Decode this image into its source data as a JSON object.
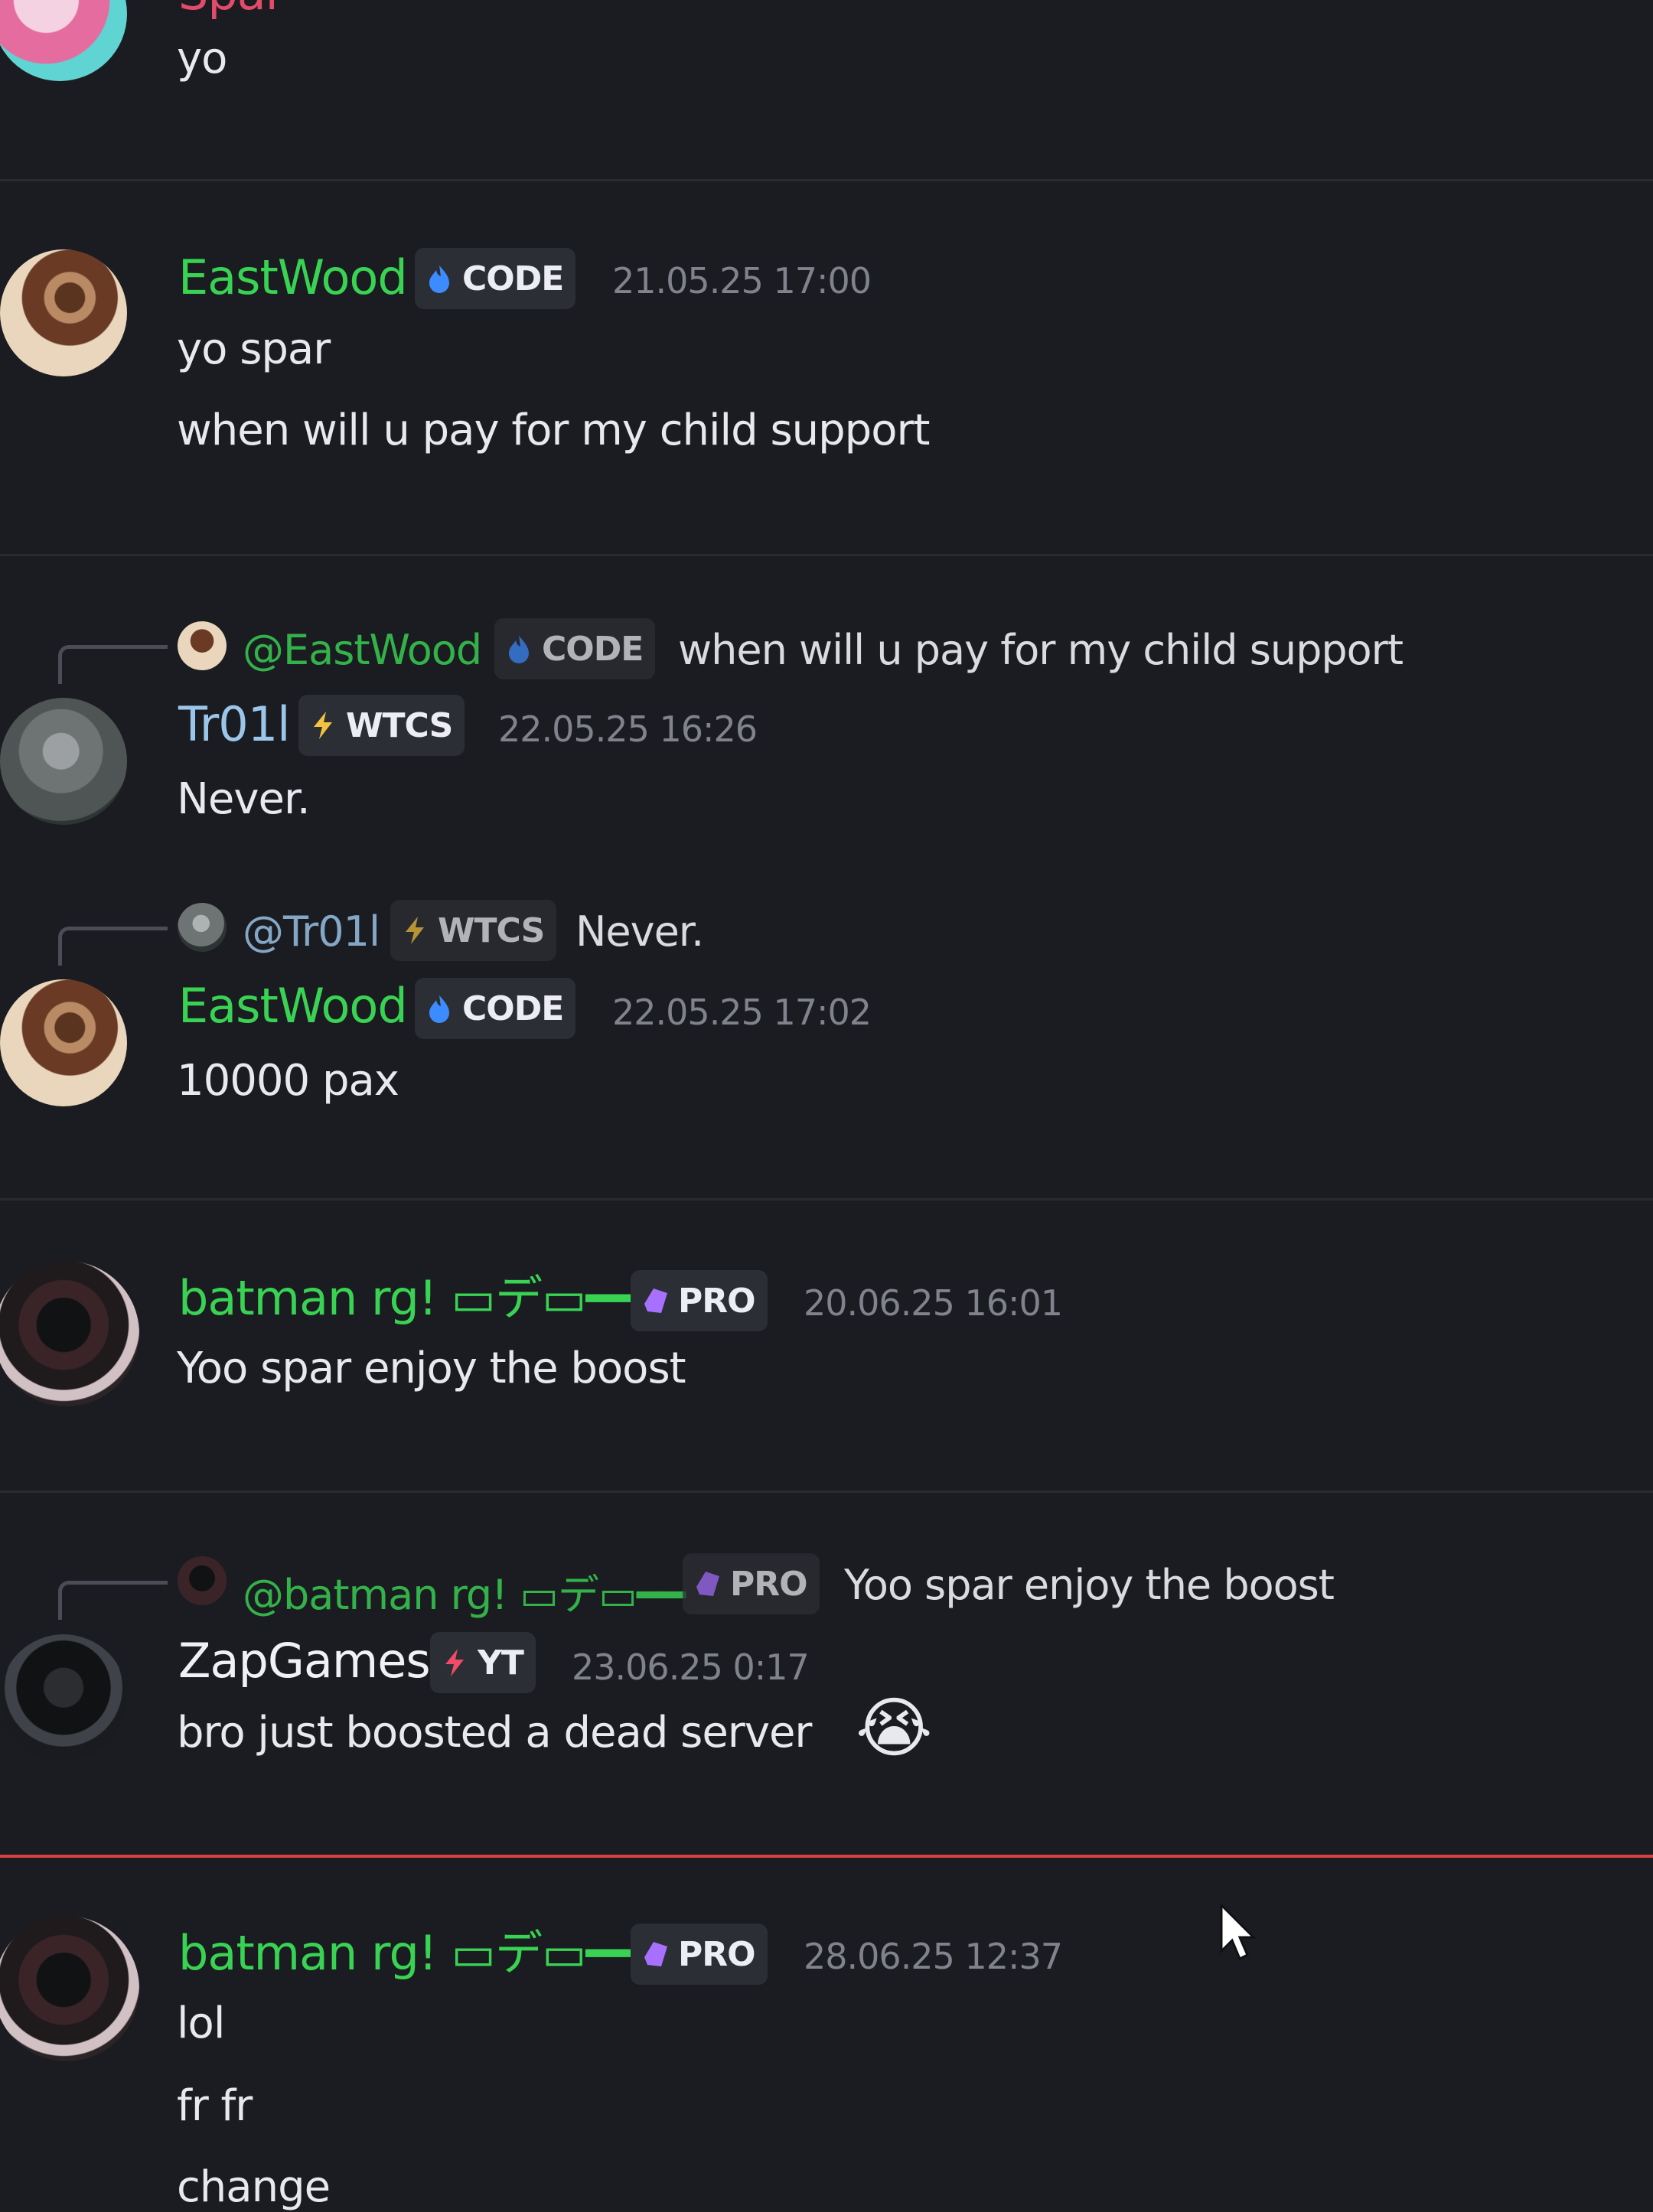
{
  "colors": {
    "background": "#1b1c21",
    "separator": "#2a2b31",
    "new_divider": "#d8413f",
    "green_name": "#39d353",
    "blue_name": "#9bc6e9",
    "timestamp": "#80838c"
  },
  "top": {
    "author": "Spar",
    "text": "yo"
  },
  "messages": [
    {
      "author": "EastWood",
      "tag": "CODE",
      "tag_icon": "blue-flame-icon",
      "timestamp": "21.05.25 17:00",
      "lines": [
        "yo spar",
        "when will u pay for my child support"
      ]
    },
    {
      "reply": {
        "author": "@EastWood",
        "tag": "CODE",
        "text": "when will u pay for my child support"
      },
      "author": "Tr01l",
      "tag": "WTCS",
      "tag_icon": "lightning-icon",
      "timestamp": "22.05.25 16:26",
      "lines": [
        "Never."
      ]
    },
    {
      "reply": {
        "author": "@Tr01l",
        "tag": "WTCS",
        "text": "Never."
      },
      "author": "EastWood",
      "tag": "CODE",
      "tag_icon": "blue-flame-icon",
      "timestamp": "22.05.25 17:02",
      "lines": [
        "10000 pax"
      ]
    },
    {
      "author": "batman rg! ▭デ▭━━",
      "tag": "PRO",
      "tag_icon": "purple-crystal-icon",
      "timestamp": "20.06.25 16:01",
      "lines": [
        "Yoo spar enjoy the boost"
      ]
    },
    {
      "reply": {
        "author": "@batman rg! ▭デ▭━━",
        "tag": "PRO",
        "text": "Yoo spar enjoy the boost"
      },
      "author": "ZapGames",
      "tag": "YT",
      "tag_icon": "red-lightning-icon",
      "timestamp": "23.06.25 0:17",
      "lines": [
        "bro just boosted a dead server",
        "😭"
      ]
    },
    {
      "author": "batman rg! ▭デ▭━━",
      "tag": "PRO",
      "tag_icon": "purple-crystal-icon",
      "timestamp": "28.06.25 12:37",
      "lines": [
        "lol",
        "fr fr",
        "change"
      ]
    }
  ]
}
